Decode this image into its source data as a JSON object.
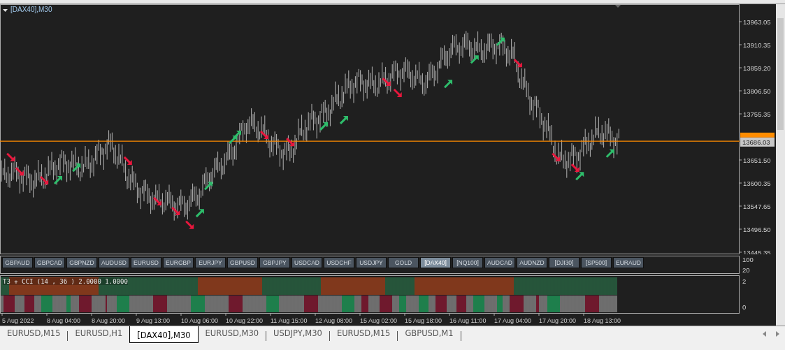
{
  "main_chart": {
    "title": "[DAX40],M30",
    "time_axis": [
      "5 Aug 2022",
      "8 Aug 04:00",
      "8 Aug 20:00",
      "9 Aug 13:00",
      "10 Aug 06:00",
      "10 Aug 22:00",
      "11 Aug 15:00",
      "12 Aug 08:00",
      "15 Aug 02:00",
      "15 Aug 18:00",
      "16 Aug 11:00",
      "17 Aug 04:00",
      "17 Aug 20:00",
      "18 Aug 13:00"
    ],
    "price_axis": [
      "13963.05",
      "13910.35",
      "13859.20",
      "13806.50",
      "13755.35",
      "13651.50",
      "13600.35",
      "13547.65",
      "13496.50",
      "13445.35"
    ],
    "signals": [
      {
        "kind": "down"
      },
      {
        "kind": "down"
      },
      {
        "kind": "down"
      },
      {
        "kind": "down"
      },
      {
        "kind": "down"
      },
      {
        "kind": "down"
      },
      {
        "kind": "down"
      },
      {
        "kind": "down"
      },
      {
        "kind": "down"
      },
      {
        "kind": "down"
      },
      {
        "kind": "down"
      },
      {
        "kind": "down"
      },
      {
        "kind": "down"
      },
      {
        "kind": "down"
      },
      {
        "kind": "up"
      },
      {
        "kind": "up"
      },
      {
        "kind": "up"
      },
      {
        "kind": "up"
      },
      {
        "kind": "up"
      },
      {
        "kind": "up"
      },
      {
        "kind": "up"
      },
      {
        "kind": "up"
      },
      {
        "kind": "up"
      },
      {
        "kind": "up"
      },
      {
        "kind": "up"
      },
      {
        "kind": "up"
      },
      {
        "kind": "up"
      }
    ],
    "price_label": "13686.03"
  },
  "symbol_buttons": [
    {
      "label": "GBPAUD",
      "selected": false
    },
    {
      "label": "GBPCAD",
      "selected": false
    },
    {
      "label": "GBPNZD",
      "selected": false
    },
    {
      "label": "AUDUSD",
      "selected": false
    },
    {
      "label": "EURUSD",
      "selected": false
    },
    {
      "label": "EURGBP",
      "selected": false
    },
    {
      "label": "EURJPY",
      "selected": false
    },
    {
      "label": "GBPUSD",
      "selected": false
    },
    {
      "label": "GBPJPY",
      "selected": false
    },
    {
      "label": "USDCAD",
      "selected": false
    },
    {
      "label": "USDCHF",
      "selected": false
    },
    {
      "label": "USDJPY",
      "selected": false
    },
    {
      "label": "GOLD",
      "selected": false
    },
    {
      "label": "[DAX40]",
      "selected": true
    },
    {
      "label": "[NQ100]",
      "selected": false
    },
    {
      "label": "AUDCAD",
      "selected": false
    },
    {
      "label": "AUDNZD",
      "selected": false
    },
    {
      "label": "[DJI30]",
      "selected": false
    },
    {
      "label": "[SP500]",
      "selected": false
    },
    {
      "label": "EURAUD",
      "selected": false
    }
  ],
  "button_panel_axis": [
    "100",
    "20"
  ],
  "indicator": {
    "title": "T3 + CCI (14 , 36 ) 2.0000 1.0000",
    "axis": [
      "2",
      "0"
    ]
  },
  "chart_tabs": [
    {
      "label": "EURUSD,M15",
      "selected": false
    },
    {
      "label": "EURUSD,H1",
      "selected": false
    },
    {
      "label": "[DAX40],M30",
      "selected": true
    },
    {
      "label": "EURUSD,M30",
      "selected": false
    },
    {
      "label": "USDJPY,M30",
      "selected": false
    },
    {
      "label": "EURUSD,M15",
      "selected": false
    },
    {
      "label": "GBPUSD,M1",
      "selected": false
    }
  ]
}
